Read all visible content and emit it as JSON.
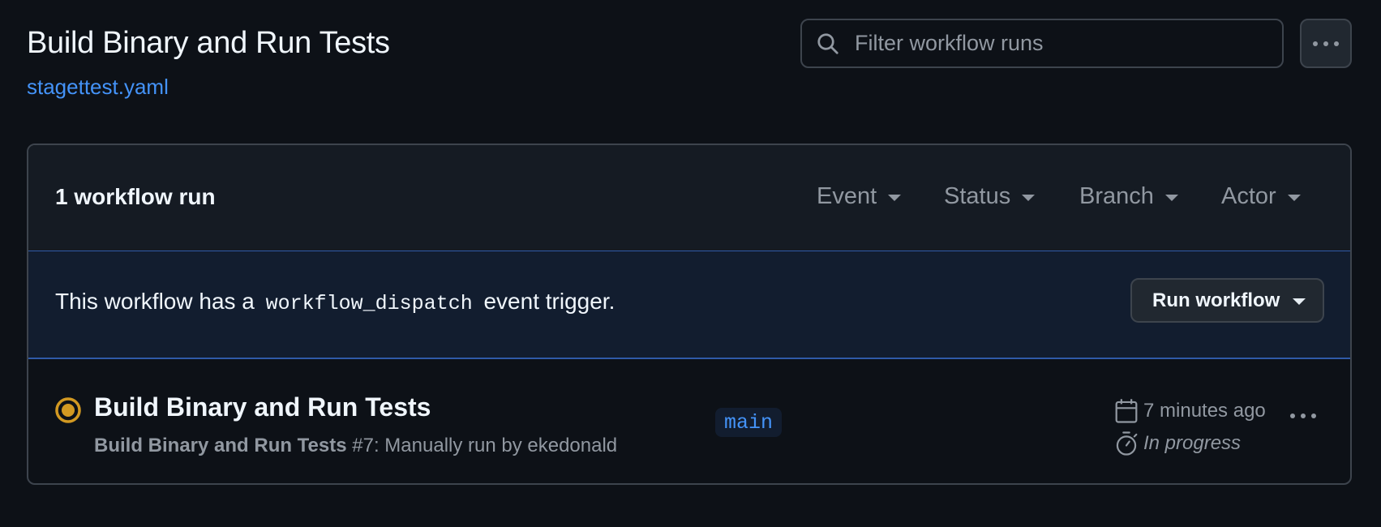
{
  "header": {
    "title": "Build Binary and Run Tests",
    "file_link": "stagettest.yaml",
    "search_placeholder": "Filter workflow runs"
  },
  "runs_box": {
    "count_label": "1 workflow run",
    "filters": [
      "Event",
      "Status",
      "Branch",
      "Actor"
    ]
  },
  "banner": {
    "text_before": "This workflow has a",
    "code": "workflow_dispatch",
    "text_after": "event trigger.",
    "run_button": "Run workflow"
  },
  "run": {
    "title": "Build Binary and Run Tests",
    "workflow_name": "Build Binary and Run Tests",
    "run_number": "#7",
    "description": ": Manually run by ekedonald",
    "branch": "main",
    "time_ago": "7 minutes ago",
    "status": "In progress",
    "status_color": "#d29922"
  },
  "colors": {
    "background": "#0d1117",
    "link": "#4493f8",
    "border": "#3d444d",
    "muted_text": "#9198a1",
    "banner_bg": "#121d2f"
  }
}
